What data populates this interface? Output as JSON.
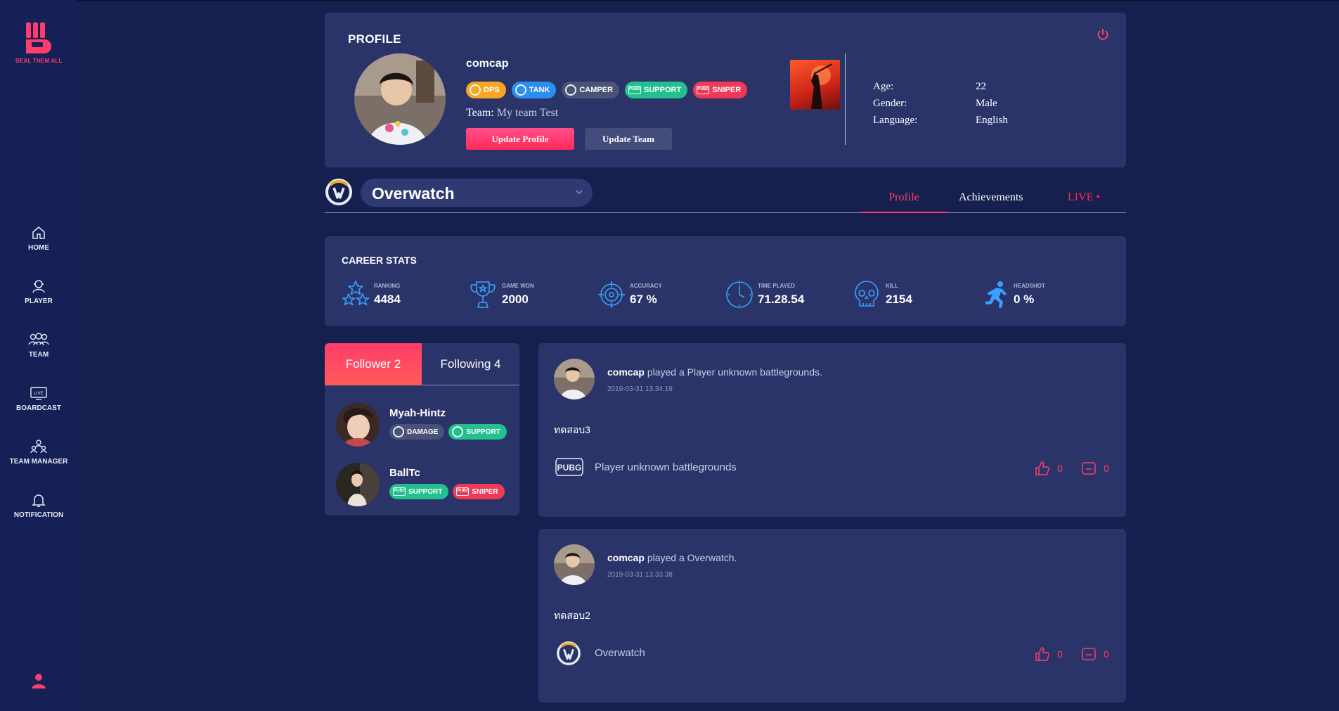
{
  "brand": {
    "logo_text": "DEAL THEM ALL"
  },
  "sidebar": {
    "items": [
      {
        "label": "HOME",
        "icon": "home-icon"
      },
      {
        "label": "PLAYER",
        "icon": "player-icon"
      },
      {
        "label": "TEAM",
        "icon": "team-icon"
      },
      {
        "label": "BOARDCAST",
        "icon": "live-icon"
      },
      {
        "label": "TEAM MANAGER",
        "icon": "team-manager-icon"
      },
      {
        "label": "NOTIFICATION",
        "icon": "bell-icon"
      }
    ]
  },
  "profile": {
    "title": "PROFILE",
    "username": "comcap",
    "tags": [
      "DPS",
      "TANK",
      "CAMPER",
      "SUPPORT",
      "SNIPER"
    ],
    "team_key": "Team:",
    "team_value": "My team Test",
    "update_profile": "Update Profile",
    "update_team": "Update Team",
    "info": [
      {
        "key": "Age:",
        "value": "22"
      },
      {
        "key": "Gender:",
        "value": "Male"
      },
      {
        "key": "Language:",
        "value": "English"
      }
    ]
  },
  "game_select": {
    "selected": "Overwatch"
  },
  "tabs": {
    "profile": "Profile",
    "achievements": "Achievements",
    "live": "LIVE •"
  },
  "career": {
    "title": "CAREER STATS",
    "stats": [
      {
        "label": "RANKING",
        "value": "4484",
        "icon": "stars-icon"
      },
      {
        "label": "GAME WON",
        "value": "2000",
        "icon": "trophy-icon"
      },
      {
        "label": "ACCURACY",
        "value": "67 %",
        "icon": "crosshair-icon"
      },
      {
        "label": "TIME PLAYED",
        "value": "71.28.54",
        "icon": "clock-icon"
      },
      {
        "label": "KILL",
        "value": "2154",
        "icon": "skull-icon"
      },
      {
        "label": "HEADSHOT",
        "value": "0 %",
        "icon": "runner-icon"
      }
    ]
  },
  "follow": {
    "follower_tab": "Follower 2",
    "following_tab": "Following 4",
    "people": [
      {
        "name": "Myah-Hintz",
        "tags": [
          "DAMAGE",
          "SUPPORT"
        ]
      },
      {
        "name": "BallTc",
        "tags": [
          "SUPPORT",
          "SNIPER"
        ]
      }
    ]
  },
  "posts": [
    {
      "user": "comcap",
      "action": "played a Player unknown battlegrounds.",
      "time": "2019-03-31 13.34.19",
      "text": "ทดสอบ3",
      "game": "Player unknown battlegrounds",
      "likes": "0",
      "comments": "0"
    },
    {
      "user": "comcap",
      "action": "played a Overwatch.",
      "time": "2019-03-31 13.33.38",
      "text": "ทดสอบ2",
      "game": "Overwatch",
      "likes": "0",
      "comments": "0"
    }
  ],
  "colors": {
    "accent": "#ff3d6a",
    "bg": "#16204f",
    "card": "#2a3469",
    "sidebar": "#142056"
  }
}
